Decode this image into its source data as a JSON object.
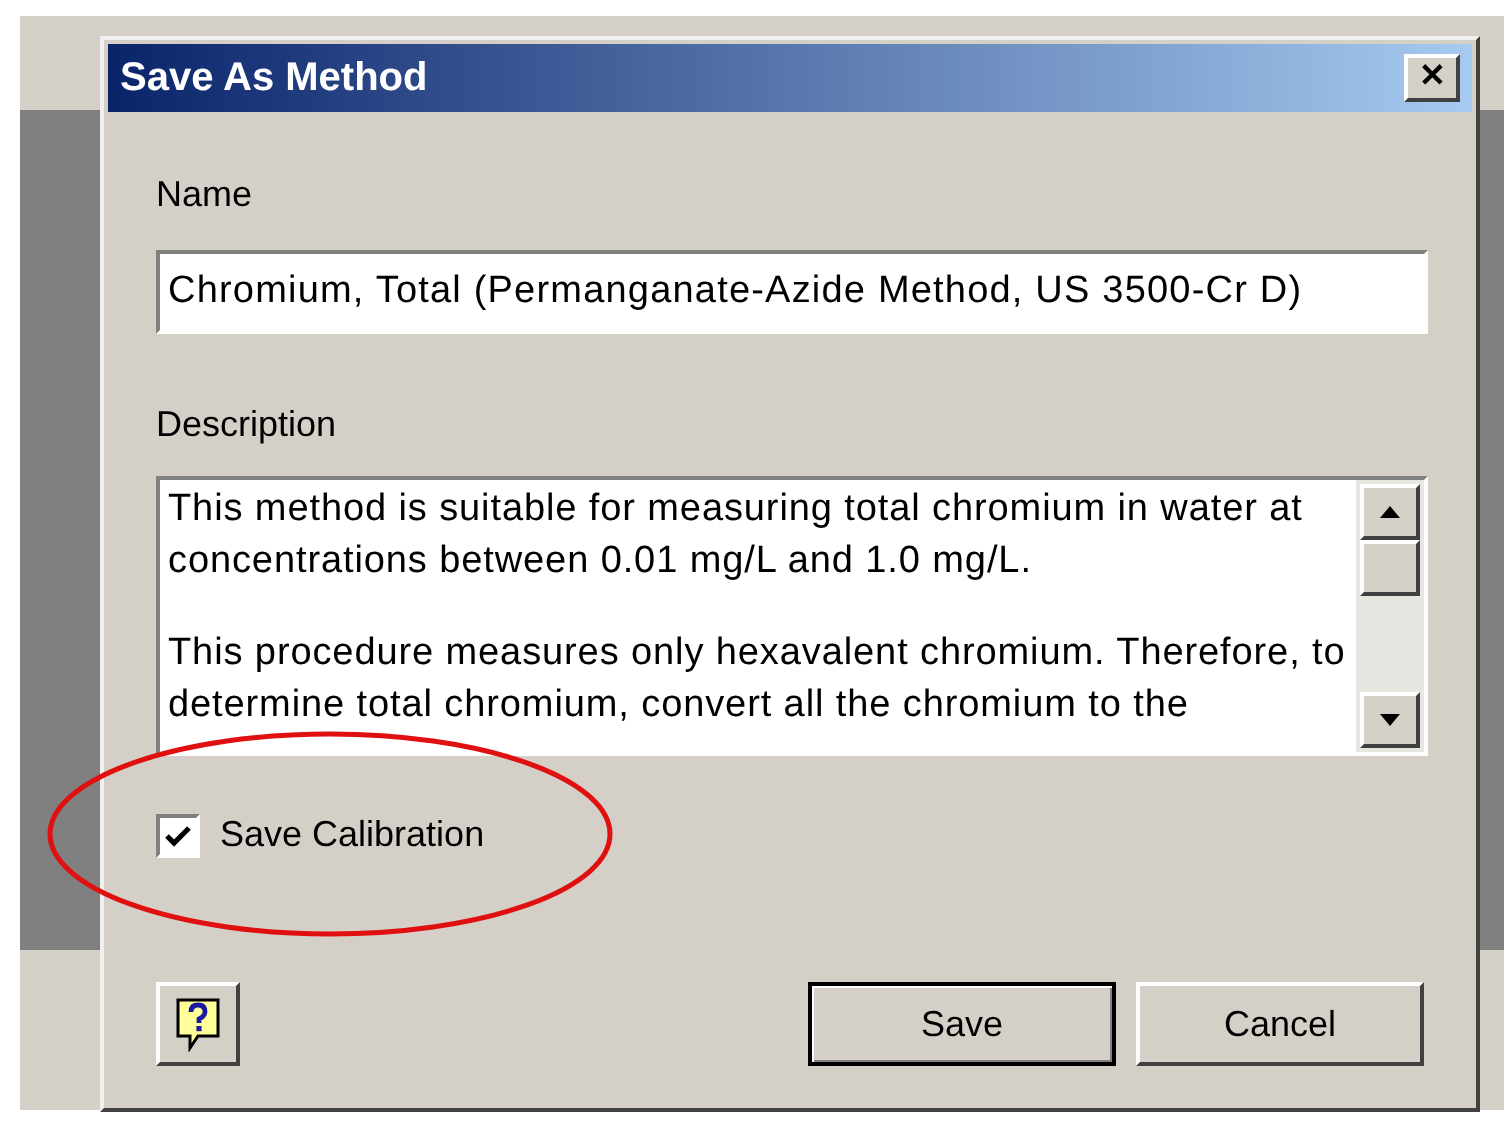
{
  "window": {
    "title": "Save As Method",
    "close": "✕"
  },
  "name": {
    "label": "Name",
    "value": "Chromium, Total (Permanganate-Azide Method, US 3500-Cr D)"
  },
  "description": {
    "label": "Description",
    "paragraphs": [
      "This method is suitable for measuring total chromium in water at concentrations between 0.01 mg/L and 1.0 mg/L.",
      "This procedure measures only hexavalent chromium. Therefore, to determine total chromium, convert all the chromium to the"
    ]
  },
  "save_calibration": {
    "label": "Save Calibration",
    "checked": true
  },
  "buttons": [
    {
      "label": "Save",
      "default": true
    },
    {
      "label": "Cancel",
      "default": false
    }
  ]
}
